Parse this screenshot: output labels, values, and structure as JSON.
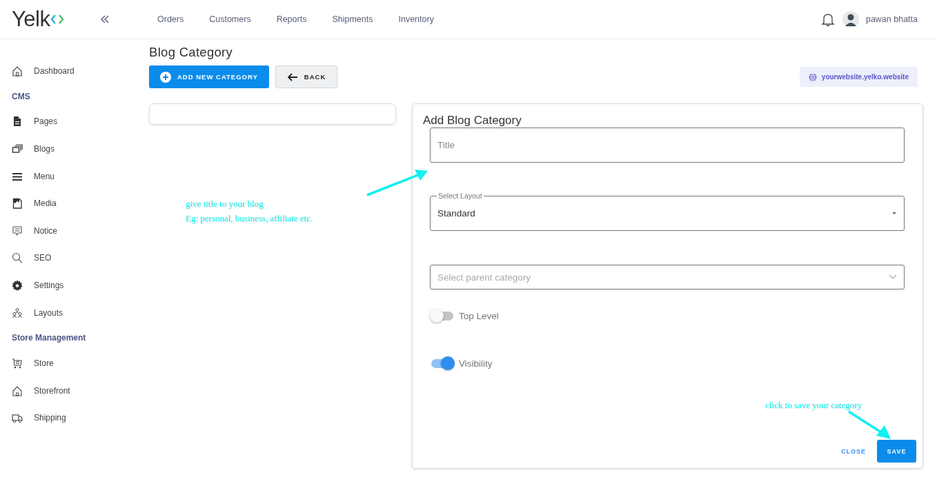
{
  "logo": {
    "text": "Yelk"
  },
  "top_nav": [
    {
      "label": "Orders"
    },
    {
      "label": "Customers"
    },
    {
      "label": "Reports"
    },
    {
      "label": "Shipments"
    },
    {
      "label": "Inventory"
    }
  ],
  "user": {
    "name": "pawan bhatta"
  },
  "sidebar": {
    "items": [
      {
        "kind": "item",
        "label": "Dashboard"
      },
      {
        "kind": "heading",
        "label": "CMS"
      },
      {
        "kind": "item",
        "label": "Pages"
      },
      {
        "kind": "item",
        "label": "Blogs"
      },
      {
        "kind": "item",
        "label": "Menu"
      },
      {
        "kind": "item",
        "label": "Media"
      },
      {
        "kind": "item",
        "label": "Notice"
      },
      {
        "kind": "item",
        "label": "SEO"
      },
      {
        "kind": "item",
        "label": "Settings"
      },
      {
        "kind": "item",
        "label": "Layouts"
      },
      {
        "kind": "heading",
        "label": "Store Management"
      },
      {
        "kind": "item",
        "label": "Store"
      },
      {
        "kind": "item",
        "label": "Storefront"
      },
      {
        "kind": "item",
        "label": "Shipping"
      }
    ]
  },
  "page": {
    "title": "Blog Category",
    "add_button": "ADD NEW CATEGORY",
    "back_button": "BACK",
    "website": "yourwebsite.yelko.website"
  },
  "form": {
    "title": "Add Blog Category",
    "title_field": {
      "placeholder": "Title"
    },
    "layout_field": {
      "label": "Select Layout",
      "value": "Standard"
    },
    "parent_field": {
      "placeholder": "Select parent category"
    },
    "toggles": [
      {
        "label": "Top Level",
        "on": false
      },
      {
        "label": "Visibility",
        "on": true
      }
    ],
    "close_button": "CLOSE",
    "save_button": "SAVE"
  },
  "annotations": [
    {
      "lines": [
        "give title to your blog",
        "Eg: personal, business, affiliate etc."
      ]
    },
    {
      "lines": [
        "click to save your category"
      ]
    }
  ]
}
